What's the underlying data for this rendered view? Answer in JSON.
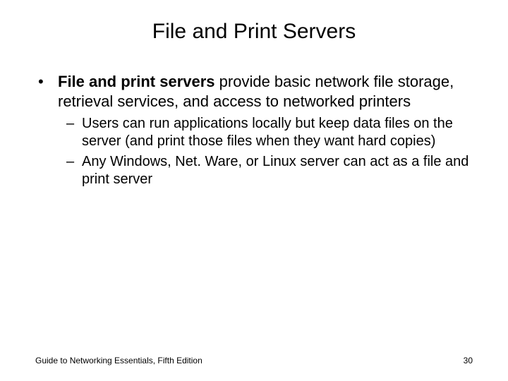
{
  "title": "File and Print Servers",
  "bullet": {
    "bold_lead": "File and print servers",
    "rest": " provide basic network file storage, retrieval services, and access to networked printers"
  },
  "sub_bullets": [
    "Users can run applications locally but keep data files on the server (and print those files when they want hard copies)",
    "Any Windows, Net. Ware, or Linux server can act as a file and print server"
  ],
  "footer": {
    "left": "Guide to Networking Essentials, Fifth Edition",
    "right": "30"
  },
  "markers": {
    "l1": "•",
    "l2": "–"
  }
}
